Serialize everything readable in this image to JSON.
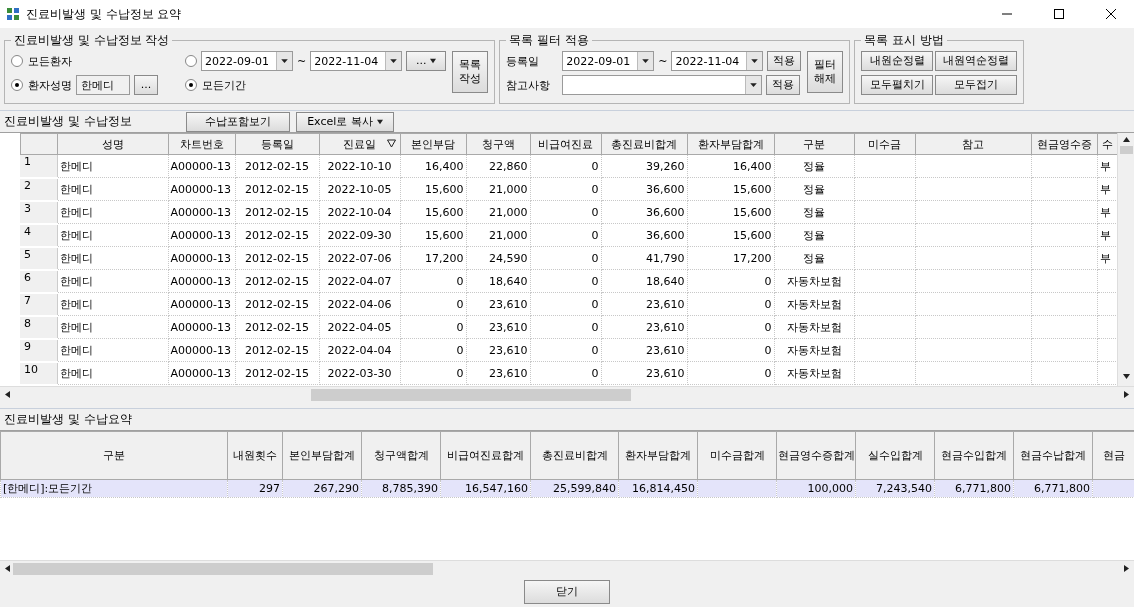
{
  "window": {
    "title": "진료비발생 및 수납정보 요약"
  },
  "compose": {
    "title": "진료비발생 및 수납정보 작성",
    "all_patients": {
      "label": "모든환자",
      "selected": false
    },
    "patient_name": {
      "label": "환자성명",
      "selected": true,
      "value": "한메디",
      "browse": "..."
    },
    "date_range": {
      "selected": false,
      "from": "2022-09-01",
      "separator": "~",
      "to": "2022-11-04",
      "menu": "..."
    },
    "all_period": {
      "label": "모든기간",
      "selected": true
    },
    "build_button": "목록 작성"
  },
  "filter": {
    "title": "목록 필터 적용",
    "reg_label": "등록일",
    "from": "2022-09-01",
    "separator": "~",
    "to": "2022-11-04",
    "apply": "적용",
    "note_label": "참고사항",
    "note_apply": "적용",
    "clear_button": "필터 해제"
  },
  "display": {
    "title": "목록 표시 방법",
    "buttons": [
      "내원순정렬",
      "내원역순정렬",
      "모두펼치기",
      "모두접기"
    ]
  },
  "grid": {
    "title": "진료비발생 및 수납정보",
    "payment_button": "수납포함보기",
    "excel_button": "Excel로 복사",
    "columns": [
      {
        "label": "성명"
      },
      {
        "label": "차트번호"
      },
      {
        "label": "등록일"
      },
      {
        "label": "진료일",
        "sorted": true
      },
      {
        "label": "본인부담"
      },
      {
        "label": "청구액"
      },
      {
        "label": "비급여진료"
      },
      {
        "label": "총진료비합계"
      },
      {
        "label": "환자부담합계"
      },
      {
        "label": "구분"
      },
      {
        "label": "미수금"
      },
      {
        "label": "참고"
      },
      {
        "label": "현금영수증"
      },
      {
        "label": "수"
      }
    ],
    "rows": [
      {
        "num": "1",
        "name": "한메디",
        "chart_no": "A00000-13",
        "registered": "2012-02-15",
        "visit_date": "2022-10-10",
        "self_pay": "16,400",
        "claim": "22,860",
        "non_covered": "0",
        "total": "39,260",
        "patient_total": "16,400",
        "category": "정율",
        "column_15": "부"
      },
      {
        "num": "2",
        "name": "한메디",
        "chart_no": "A00000-13",
        "registered": "2012-02-15",
        "visit_date": "2022-10-05",
        "self_pay": "15,600",
        "claim": "21,000",
        "non_covered": "0",
        "total": "36,600",
        "patient_total": "15,600",
        "category": "정율",
        "column_15": "부"
      },
      {
        "num": "3",
        "name": "한메디",
        "chart_no": "A00000-13",
        "registered": "2012-02-15",
        "visit_date": "2022-10-04",
        "self_pay": "15,600",
        "claim": "21,000",
        "non_covered": "0",
        "total": "36,600",
        "patient_total": "15,600",
        "category": "정율",
        "column_15": "부"
      },
      {
        "num": "4",
        "name": "한메디",
        "chart_no": "A00000-13",
        "registered": "2012-02-15",
        "visit_date": "2022-09-30",
        "self_pay": "15,600",
        "claim": "21,000",
        "non_covered": "0",
        "total": "36,600",
        "patient_total": "15,600",
        "category": "정율",
        "column_15": "부"
      },
      {
        "num": "5",
        "name": "한메디",
        "chart_no": "A00000-13",
        "registered": "2012-02-15",
        "visit_date": "2022-07-06",
        "self_pay": "17,200",
        "claim": "24,590",
        "non_covered": "0",
        "total": "41,790",
        "patient_total": "17,200",
        "category": "정율",
        "column_15": "부"
      },
      {
        "num": "6",
        "name": "한메디",
        "chart_no": "A00000-13",
        "registered": "2012-02-15",
        "visit_date": "2022-04-07",
        "self_pay": "0",
        "claim": "18,640",
        "non_covered": "0",
        "total": "18,640",
        "patient_total": "0",
        "category": "자동차보험"
      },
      {
        "num": "7",
        "name": "한메디",
        "chart_no": "A00000-13",
        "registered": "2012-02-15",
        "visit_date": "2022-04-06",
        "self_pay": "0",
        "claim": "23,610",
        "non_covered": "0",
        "total": "23,610",
        "patient_total": "0",
        "category": "자동차보험"
      },
      {
        "num": "8",
        "name": "한메디",
        "chart_no": "A00000-13",
        "registered": "2012-02-15",
        "visit_date": "2022-04-05",
        "self_pay": "0",
        "claim": "23,610",
        "non_covered": "0",
        "total": "23,610",
        "patient_total": "0",
        "category": "자동차보험"
      },
      {
        "num": "9",
        "name": "한메디",
        "chart_no": "A00000-13",
        "registered": "2012-02-15",
        "visit_date": "2022-04-04",
        "self_pay": "0",
        "claim": "23,610",
        "non_covered": "0",
        "total": "23,610",
        "patient_total": "0",
        "category": "자동차보험"
      },
      {
        "num": "10",
        "name": "한메디",
        "chart_no": "A00000-13",
        "registered": "2012-02-15",
        "visit_date": "2022-03-30",
        "self_pay": "0",
        "claim": "23,610",
        "non_covered": "0",
        "total": "23,610",
        "patient_total": "0",
        "category": "자동차보험"
      }
    ]
  },
  "summary": {
    "title": "진료비발생 및 수납요약",
    "columns": [
      {
        "label": "구분"
      },
      {
        "label": "내원횟수"
      },
      {
        "label": "본인부담합계"
      },
      {
        "label": "청구액합계"
      },
      {
        "label": "비급여진료합계"
      },
      {
        "label": "총진료비합계"
      },
      {
        "label": "환자부담합계"
      },
      {
        "label": "미수금합계"
      },
      {
        "label": "현금영수증합계"
      },
      {
        "label": "실수입합계"
      },
      {
        "label": "현금수입합계"
      },
      {
        "label": "현금수납합계"
      },
      {
        "label": "현금"
      }
    ],
    "rows": [
      {
        "selected": true,
        "category": "[한메디]:모든기간",
        "visits": "297",
        "self_pay": "267,290",
        "claim": "8,785,390",
        "non_covered": "16,547,160",
        "total": "25,599,840",
        "patient_total": "16,814,450",
        "cash_receipt": "100,000",
        "net_income": "7,243,540",
        "cash_income": "6,771,800",
        "cash_paid": "6,771,800"
      }
    ]
  },
  "close_button": "닫기"
}
